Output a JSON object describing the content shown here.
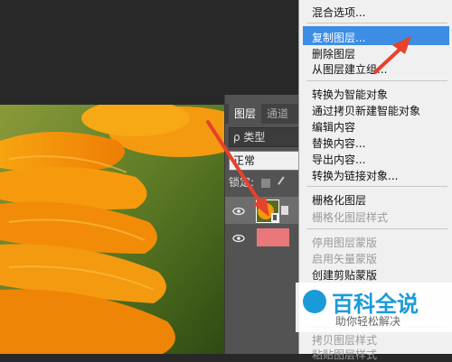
{
  "layers_panel": {
    "tabs": [
      "图层",
      "通道"
    ],
    "filter_label": "ρ 类型",
    "blend_mode": "正常",
    "lock_label": "锁定:"
  },
  "context_menu": {
    "items": [
      {
        "label": "混合选项...",
        "disabled": false
      },
      {
        "label": "复制图层...",
        "disabled": false,
        "highlighted": true
      },
      {
        "label": "删除图层",
        "disabled": false
      },
      {
        "label": "从图层建立组...",
        "disabled": false
      },
      {
        "label": "转换为智能对象",
        "disabled": false
      },
      {
        "label": "通过拷贝新建智能对象",
        "disabled": false
      },
      {
        "label": "编辑内容",
        "disabled": false
      },
      {
        "label": "替换内容...",
        "disabled": false
      },
      {
        "label": "导出内容...",
        "disabled": false
      },
      {
        "label": "转换为链接对象...",
        "disabled": false
      },
      {
        "label": "栅格化图层",
        "disabled": false
      },
      {
        "label": "栅格化图层样式",
        "disabled": true
      },
      {
        "label": "停用图层蒙版",
        "disabled": true
      },
      {
        "label": "启用矢量蒙版",
        "disabled": true
      },
      {
        "label": "创建剪贴蒙版",
        "disabled": false
      },
      {
        "label": "拷贝图层样式",
        "disabled": true
      },
      {
        "label": "粘贴图层样式",
        "disabled": true
      }
    ]
  },
  "watermark": {
    "title": "百科全说",
    "subtitle": "助你轻松解决"
  },
  "colors": {
    "highlight": "#3d8de4",
    "arrow": "#e8412c",
    "layer2_swatch": "#e8787a"
  }
}
